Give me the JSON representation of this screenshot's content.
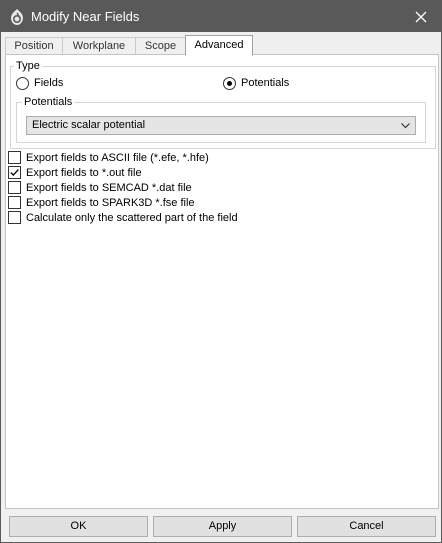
{
  "window": {
    "title": "Modify Near Fields"
  },
  "tabs": [
    {
      "label": "Position"
    },
    {
      "label": "Workplane"
    },
    {
      "label": "Scope"
    },
    {
      "label": "Advanced"
    }
  ],
  "type_group": {
    "label": "Type",
    "options": [
      {
        "label": "Fields",
        "selected": false
      },
      {
        "label": "Potentials",
        "selected": true
      }
    ]
  },
  "potentials_group": {
    "label": "Potentials",
    "selected_value": "Electric scalar potential"
  },
  "checkboxes": [
    {
      "label": "Export fields to ASCII file (*.efe, *.hfe)",
      "checked": false
    },
    {
      "label": "Export fields to *.out file",
      "checked": true
    },
    {
      "label": "Export fields to SEMCAD *.dat file",
      "checked": false
    },
    {
      "label": "Export fields to SPARK3D *.fse file",
      "checked": false
    },
    {
      "label": "Calculate only the scattered part of the field",
      "checked": false
    }
  ],
  "buttons": {
    "ok": "OK",
    "apply": "Apply",
    "cancel": "Cancel"
  }
}
